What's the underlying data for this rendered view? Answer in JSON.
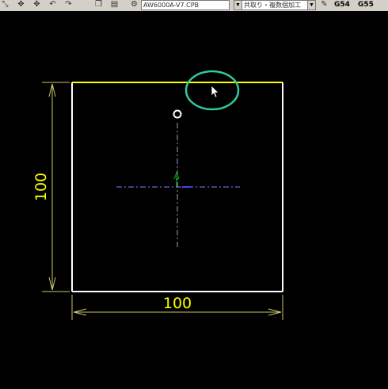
{
  "toolbar": {
    "file_combo": "AW6000A-V7.CPB",
    "mode_combo": "共取り・複数個加工",
    "g54": "G54",
    "g55": "G55",
    "icons": [
      "zoom-icon",
      "measure-icon",
      "measure-alt-icon",
      "undo-icon",
      "redo-icon",
      "copy-icon",
      "paste-icon",
      "settings-icon",
      "tool-icon"
    ]
  },
  "drawing": {
    "colors": {
      "background": "#000000",
      "top_edge": "#ffff00",
      "outline": "#ffffff",
      "dimension": "#ffff00",
      "dimension_line": "#c8c86e",
      "centerline": "#8080ff",
      "highlight_circle": "#30c8a0",
      "axis_arrow": "#00c000"
    },
    "width_label": "100",
    "height_label": "100"
  }
}
